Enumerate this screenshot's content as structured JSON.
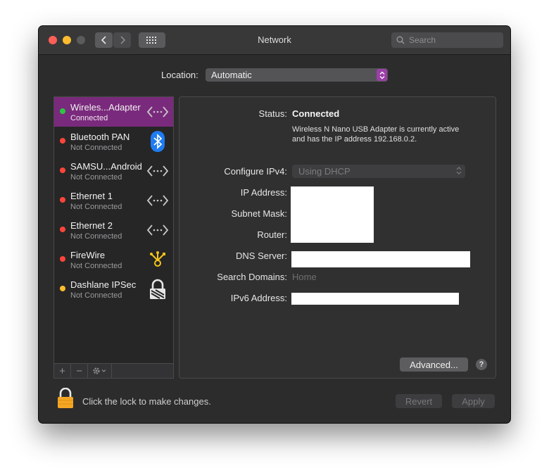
{
  "window": {
    "title": "Network"
  },
  "search": {
    "placeholder": "Search"
  },
  "location": {
    "label": "Location:",
    "value": "Automatic"
  },
  "colors": {
    "accent": "#9b3fa8",
    "selected_row": "#7a2a7c",
    "status_green": "#28c940",
    "status_red": "#ff453a",
    "status_yellow": "#febc2e"
  },
  "services": [
    {
      "name": "Wireles...Adapter",
      "status": "Connected",
      "dot": "green",
      "icon": "ethernet-arrows-icon",
      "selected": true
    },
    {
      "name": "Bluetooth PAN",
      "status": "Not Connected",
      "dot": "red",
      "icon": "bluetooth-icon"
    },
    {
      "name": "SAMSU...Android",
      "status": "Not Connected",
      "dot": "red",
      "icon": "ethernet-arrows-icon"
    },
    {
      "name": "Ethernet 1",
      "status": "Not Connected",
      "dot": "red",
      "icon": "ethernet-arrows-icon"
    },
    {
      "name": "Ethernet 2",
      "status": "Not Connected",
      "dot": "red",
      "icon": "ethernet-arrows-icon"
    },
    {
      "name": "FireWire",
      "status": "Not Connected",
      "dot": "red",
      "icon": "firewire-icon"
    },
    {
      "name": "Dashlane IPSec",
      "status": "Not Connected",
      "dot": "yellow",
      "icon": "vpn-lock-icon"
    }
  ],
  "sidebar_footer": {
    "add": "+",
    "remove": "−"
  },
  "details": {
    "status_label": "Status:",
    "status_value": "Connected",
    "status_desc": "Wireless N Nano USB Adapter is currently active and has the IP address 192.168.0.2.",
    "configure_label": "Configure IPv4:",
    "configure_value": "Using DHCP",
    "ip_label": "IP Address:",
    "subnet_label": "Subnet Mask:",
    "router_label": "Router:",
    "dns_label": "DNS Server:",
    "search_domains_label": "Search Domains:",
    "search_domains_value": "Home",
    "ipv6_label": "IPv6 Address:"
  },
  "buttons": {
    "advanced": "Advanced...",
    "help": "?",
    "revert": "Revert",
    "apply": "Apply"
  },
  "lock": {
    "text": "Click the lock to make changes."
  }
}
